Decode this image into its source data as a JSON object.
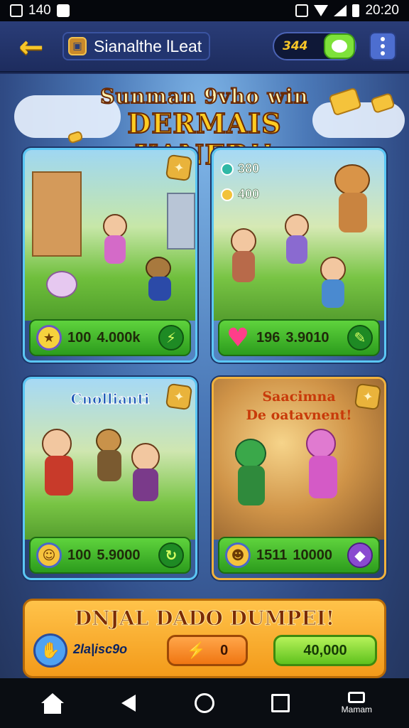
{
  "status_bar": {
    "time_left": "140",
    "time_right": "20:20"
  },
  "header": {
    "title": "Sianalthe lLeat",
    "coin_value": "344",
    "back_label": "←"
  },
  "headline": {
    "line1": "Sunman 9vho win",
    "line2": "DERMAIS KANER!!"
  },
  "cards": [
    {
      "kind": "blue",
      "stat_a": "100",
      "stat_b": "4.000k",
      "end_icon": "lightning-icon"
    },
    {
      "kind": "blue",
      "top_stat_1": "380",
      "top_stat_2": "400",
      "stat_a": "196",
      "stat_b": "3.9010",
      "end_icon": "pencil-icon"
    },
    {
      "kind": "blue",
      "title": "Cnollianti",
      "stat_a": "100",
      "stat_b": "5.9000",
      "end_icon": "swirl-icon"
    },
    {
      "kind": "gold",
      "title_1": "Saacimna",
      "title_2": "De oatavnent!",
      "stat_a": "1511",
      "stat_b": "10000",
      "end_icon": "crystal-icon"
    }
  ],
  "banner": {
    "title": "DNJAL DADO DUMPEI!",
    "label": "2la|isc9o",
    "orange_btn_value": "0",
    "green_btn_value": "40,000"
  },
  "nav": {
    "menu_label": "Mamam"
  },
  "colors": {
    "accent_yellow": "#f7c628",
    "card_border_blue": "#5bc7f5",
    "card_border_gold": "#f2b23c",
    "bar_green": "#5fd33d"
  }
}
